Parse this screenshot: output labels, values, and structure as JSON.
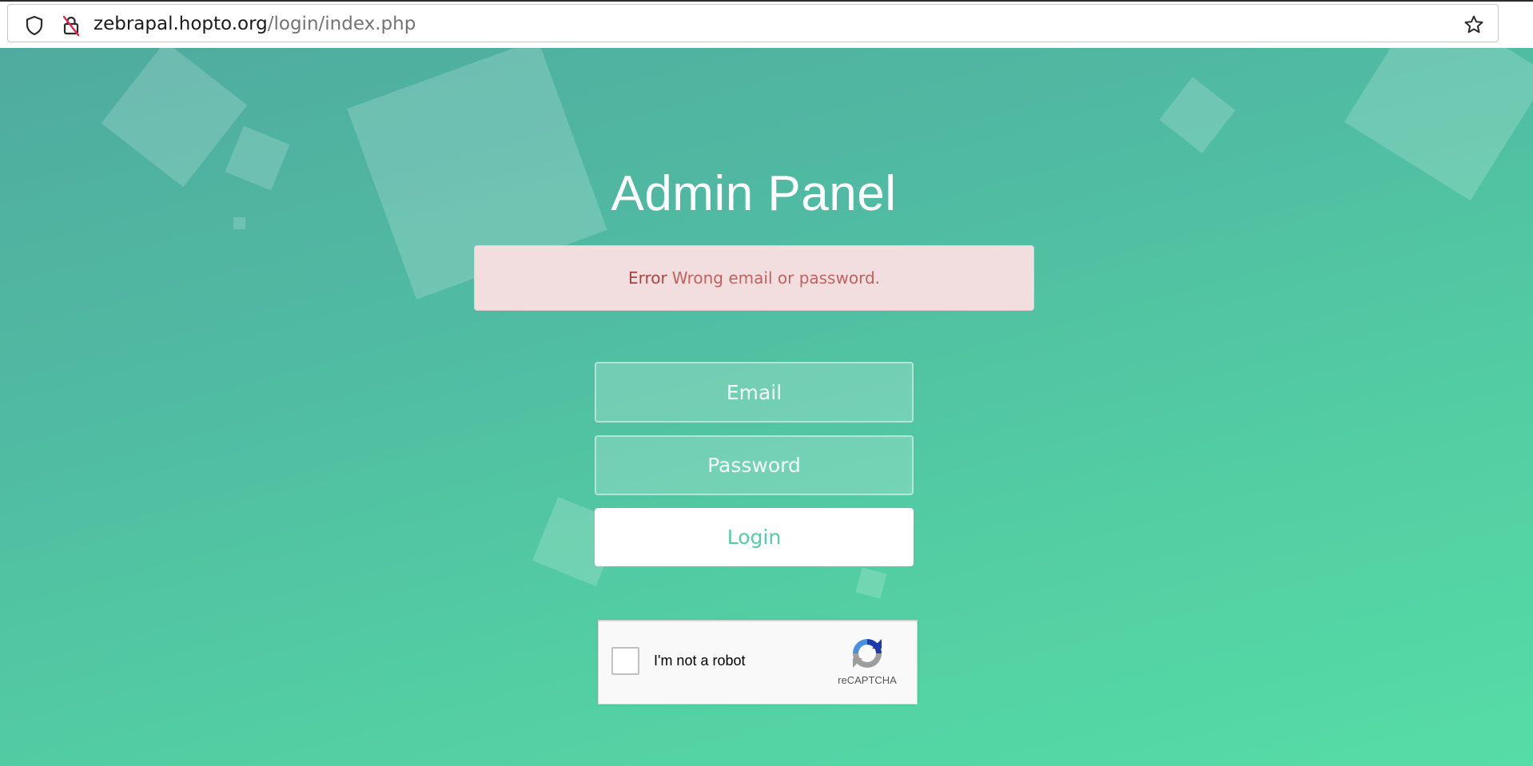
{
  "browser": {
    "url_host": "zebrapal.hopto.org",
    "url_path": "/login/index.php",
    "icons": [
      "shield-icon",
      "insecure-lock-icon",
      "bookmark-star-icon"
    ]
  },
  "page": {
    "title": "Admin Panel",
    "error": {
      "strong": "Error",
      "message": "Wrong email or password."
    },
    "form": {
      "email_placeholder": "Email",
      "password_placeholder": "Password",
      "login_label": "Login"
    },
    "recaptcha": {
      "label": "I'm not a robot",
      "brand": "reCAPTCHA"
    },
    "colors": {
      "background_start": "#4fab9f",
      "background_end": "#56dca6",
      "error_background": "#f2dede",
      "error_text": "#a94442",
      "login_text": "#53cfa3"
    }
  }
}
